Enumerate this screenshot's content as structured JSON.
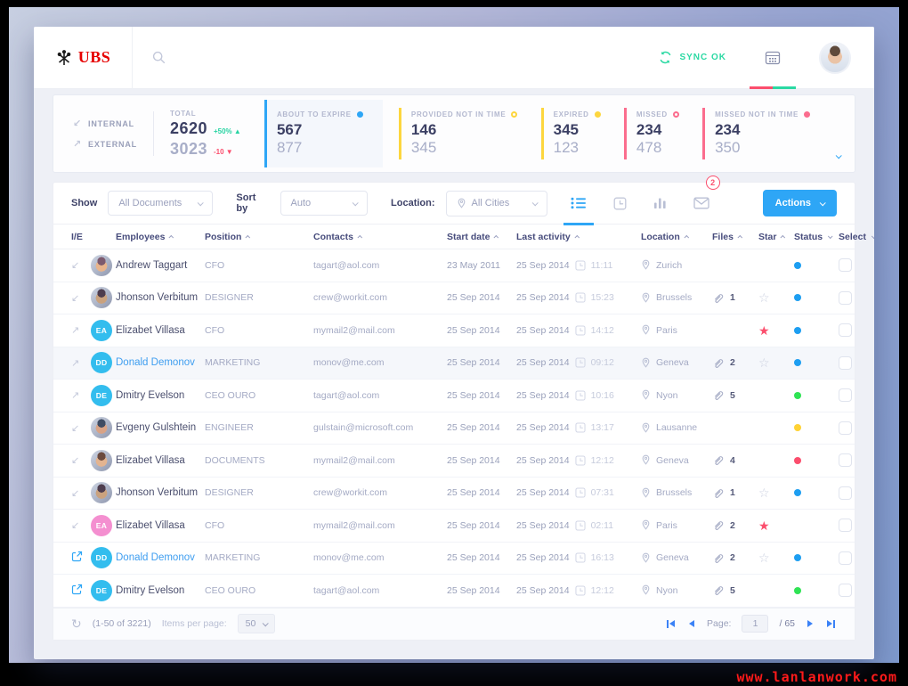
{
  "watermark": "www.lanlanwork.com",
  "header": {
    "brand": "UBS",
    "sync_label": "SYNC OK"
  },
  "stats": {
    "internal_label": "INTERNAL",
    "external_label": "EXTERNAL",
    "total_label": "TOTAL",
    "total_internal": "2620",
    "total_internal_delta": "+50%",
    "total_external": "3023",
    "total_external_delta": "-10",
    "cards": [
      {
        "label": "ABOUT TO EXPIRE",
        "top": "567",
        "bottom": "877",
        "accent": "#2ea6f6",
        "dot_filled": true,
        "active": true
      },
      {
        "label": "PROVIDED NOT IN TIME",
        "top": "146",
        "bottom": "345",
        "accent": "#fdd63e",
        "dot_filled": false,
        "active": false
      },
      {
        "label": "EXPIRED",
        "top": "345",
        "bottom": "123",
        "accent": "#fdd63e",
        "dot_filled": true,
        "active": false
      },
      {
        "label": "MISSED",
        "top": "234",
        "bottom": "478",
        "accent": "#fb6d8e",
        "dot_filled": false,
        "active": false
      },
      {
        "label": "MISSED NOT IN TIME",
        "top": "234",
        "bottom": "350",
        "accent": "#fb6d8e",
        "dot_filled": true,
        "active": false
      }
    ]
  },
  "filters": {
    "show_label": "Show",
    "show_value": "All Documents",
    "sort_label": "Sort by",
    "sort_value": "Auto",
    "location_label": "Location:",
    "location_value": "All Cities",
    "mail_badge": "2",
    "actions_label": "Actions"
  },
  "table": {
    "columns": [
      {
        "label": "I/E",
        "sort": null
      },
      {
        "label": "Employees",
        "sort": "up"
      },
      {
        "label": "Position",
        "sort": "up"
      },
      {
        "label": "Contacts",
        "sort": "up"
      },
      {
        "label": "Start date",
        "sort": "up"
      },
      {
        "label": "Last activity",
        "sort": "up"
      },
      {
        "label": "Location",
        "sort": "up"
      },
      {
        "label": "Files",
        "sort": "up"
      },
      {
        "label": "Star",
        "sort": "up"
      },
      {
        "label": "Status",
        "sort": "down"
      },
      {
        "label": "Select",
        "sort": "down"
      }
    ],
    "status_colors": {
      "blue": "#1d9ef1",
      "green": "#2fe354",
      "yellow": "#ffd234",
      "red": "#fb4e6d"
    },
    "rows": [
      {
        "ie": "in",
        "avatar": {
          "type": "photo",
          "tones": [
            "#e8b48c",
            "#7c5a6e"
          ]
        },
        "name": "Andrew Taggart",
        "link": false,
        "position": "CFO",
        "contact": "tagart@aol.com",
        "start_date": "23 May 2011",
        "activity_date": "25 Sep 2014",
        "activity_time": "11:11",
        "location": "Zurich",
        "files": null,
        "star": "none",
        "status": "blue",
        "highlighted": false
      },
      {
        "ie": "in",
        "avatar": {
          "type": "photo",
          "tones": [
            "#caa27e",
            "#4e3d4e"
          ]
        },
        "name": "Jhonson Verbitum",
        "link": false,
        "position": "DESIGNER",
        "contact": "crew@workit.com",
        "start_date": "25 Sep 2014",
        "activity_date": "25 Sep 2014",
        "activity_time": "15:23",
        "location": "Brussels",
        "files": 1,
        "star": "outline",
        "status": "blue",
        "highlighted": false
      },
      {
        "ie": "out",
        "avatar": {
          "type": "initials",
          "initials": "EA",
          "color": "#33bdee"
        },
        "name": "Elizabet Villasa",
        "link": false,
        "position": "CFO",
        "contact": "mymail2@mail.com",
        "start_date": "25 Sep 2014",
        "activity_date": "25 Sep 2014",
        "activity_time": "14:12",
        "location": "Paris",
        "files": null,
        "star": "filled",
        "status": "blue",
        "highlighted": false
      },
      {
        "ie": "out",
        "avatar": {
          "type": "initials",
          "initials": "DD",
          "color": "#33bdee"
        },
        "name": "Donald Demonov",
        "link": true,
        "position": "MARKETING",
        "contact": "monov@me.com",
        "start_date": "25 Sep 2014",
        "activity_date": "25 Sep 2014",
        "activity_time": "09:12",
        "location": "Geneva",
        "files": 2,
        "star": "outline",
        "status": "blue",
        "highlighted": true
      },
      {
        "ie": "out",
        "avatar": {
          "type": "initials",
          "initials": "DE",
          "color": "#33bdee"
        },
        "name": "Dmitry Evelson",
        "link": false,
        "position": "CEO OURO",
        "contact": "tagart@aol.com",
        "start_date": "25 Sep 2014",
        "activity_date": "25 Sep 2014",
        "activity_time": "10:16",
        "location": "Nyon",
        "files": 5,
        "star": "none",
        "status": "green",
        "highlighted": false
      },
      {
        "ie": "in",
        "avatar": {
          "type": "photo",
          "tones": [
            "#d9a386",
            "#3f4c63"
          ]
        },
        "name": "Evgeny Gulshtein",
        "link": false,
        "position": "ENGINEER",
        "contact": "gulstain@microsoft.com",
        "start_date": "25 Sep 2014",
        "activity_date": "25 Sep 2014",
        "activity_time": "13:17",
        "location": "Lausanne",
        "files": null,
        "star": "none",
        "status": "yellow",
        "highlighted": false
      },
      {
        "ie": "in",
        "avatar": {
          "type": "photo",
          "tones": [
            "#e3b490",
            "#6b4a3f"
          ]
        },
        "name": "Elizabet Villasa",
        "link": false,
        "position": "DOCUMENTS",
        "contact": "mymail2@mail.com",
        "start_date": "25 Sep 2014",
        "activity_date": "25 Sep 2014",
        "activity_time": "12:12",
        "location": "Geneva",
        "files": 4,
        "star": "none",
        "status": "red",
        "highlighted": false
      },
      {
        "ie": "in",
        "avatar": {
          "type": "photo",
          "tones": [
            "#caa27e",
            "#4e3d4e"
          ]
        },
        "name": "Jhonson Verbitum",
        "link": false,
        "position": "DESIGNER",
        "contact": "crew@workit.com",
        "start_date": "25 Sep 2014",
        "activity_date": "25 Sep 2014",
        "activity_time": "07:31",
        "location": "Brussels",
        "files": 1,
        "star": "outline",
        "status": "blue",
        "highlighted": false
      },
      {
        "ie": "in",
        "avatar": {
          "type": "initials",
          "initials": "EA",
          "color": "#f48fd0"
        },
        "name": "Elizabet Villasa",
        "link": false,
        "position": "CFO",
        "contact": "mymail2@mail.com",
        "start_date": "25 Sep 2014",
        "activity_date": "25 Sep 2014",
        "activity_time": "02:11",
        "location": "Paris",
        "files": 2,
        "star": "filled",
        "status": "none",
        "highlighted": false
      },
      {
        "ie": "link",
        "avatar": {
          "type": "initials",
          "initials": "DD",
          "color": "#33bdee"
        },
        "name": "Donald Demonov",
        "link": true,
        "position": "MARKETING",
        "contact": "monov@me.com",
        "start_date": "25 Sep 2014",
        "activity_date": "25 Sep 2014",
        "activity_time": "16:13",
        "location": "Geneva",
        "files": 2,
        "star": "outline",
        "status": "blue",
        "highlighted": false
      },
      {
        "ie": "link",
        "avatar": {
          "type": "initials",
          "initials": "DE",
          "color": "#33bdee"
        },
        "name": "Dmitry Evelson",
        "link": false,
        "position": "CEO OURO",
        "contact": "tagart@aol.com",
        "start_date": "25 Sep 2014",
        "activity_date": "25 Sep 2014",
        "activity_time": "12:12",
        "location": "Nyon",
        "files": 5,
        "star": "none",
        "status": "green",
        "highlighted": false
      }
    ]
  },
  "footer": {
    "range": "(1-50 of 3221)",
    "items_label": "Items per page:",
    "items_value": "50",
    "page_label": "Page:",
    "page_value": "1",
    "page_total": "/ 65"
  }
}
